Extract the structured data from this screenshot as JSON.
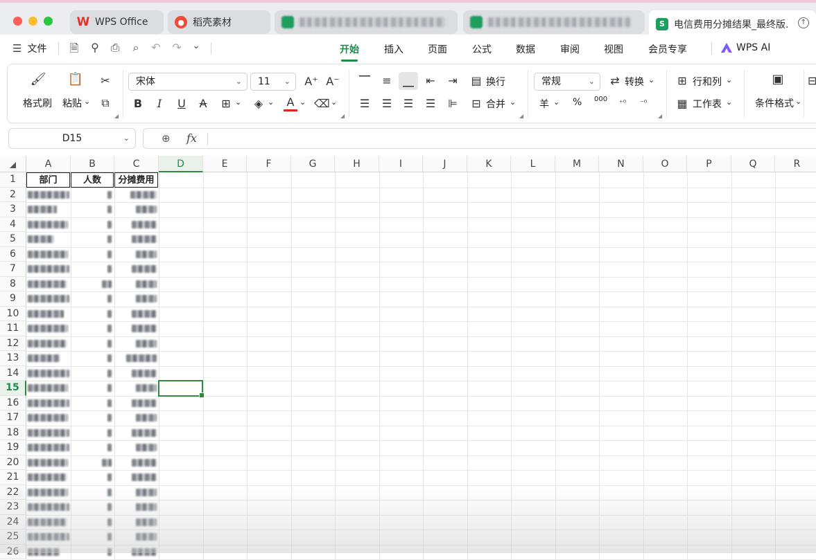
{
  "window_tabs": [
    {
      "label": "WPS Office",
      "icon": "wps-logo-icon"
    },
    {
      "label": "稻壳素材",
      "icon": "daoke-logo-icon"
    },
    {
      "label": "",
      "icon": "sheet-icon",
      "blurred": true
    },
    {
      "label": "",
      "icon": "sheet-icon",
      "blurred": true
    },
    {
      "label": "电信费用分摊结果_最终版.",
      "icon": "sheet-icon",
      "active": true
    }
  ],
  "menu": {
    "file": "文件",
    "tabs": [
      "开始",
      "插入",
      "页面",
      "公式",
      "数据",
      "审阅",
      "视图",
      "会员专享"
    ],
    "active_tab": "开始",
    "ai": "WPS AI"
  },
  "ribbon": {
    "format_painter": "格式刷",
    "paste": "粘贴",
    "font_name": "宋体",
    "font_size": "11",
    "wrap": "换行",
    "merge": "合并",
    "number_format": "常规",
    "convert": "转换",
    "rows_cols": "行和列",
    "worksheet": "工作表",
    "conditional_format": "条件格式",
    "currency_symbol": "羊",
    "percent_symbol": "%",
    "thousands_symbol": "000"
  },
  "formula_bar": {
    "name_box": "D15",
    "fx": "fx",
    "content": ""
  },
  "sheet": {
    "columns": [
      "A",
      "B",
      "C",
      "D",
      "E",
      "F",
      "G",
      "H",
      "I",
      "J",
      "K",
      "L",
      "M",
      "N",
      "O",
      "P",
      "Q",
      "R"
    ],
    "selected_column": "D",
    "rows": [
      "1",
      "2",
      "3",
      "4",
      "5",
      "6",
      "7",
      "8",
      "9",
      "10",
      "11",
      "12",
      "13",
      "14",
      "15",
      "16",
      "17",
      "18",
      "19",
      "20",
      "21",
      "22",
      "23",
      "24",
      "25",
      "26"
    ],
    "selected_row": "15",
    "headers": [
      "部门",
      "人数",
      "分摊费用"
    ],
    "data_blurred": true
  },
  "colors": {
    "accent": "#1f8a4c",
    "selection_border": "#2e8b3e"
  }
}
